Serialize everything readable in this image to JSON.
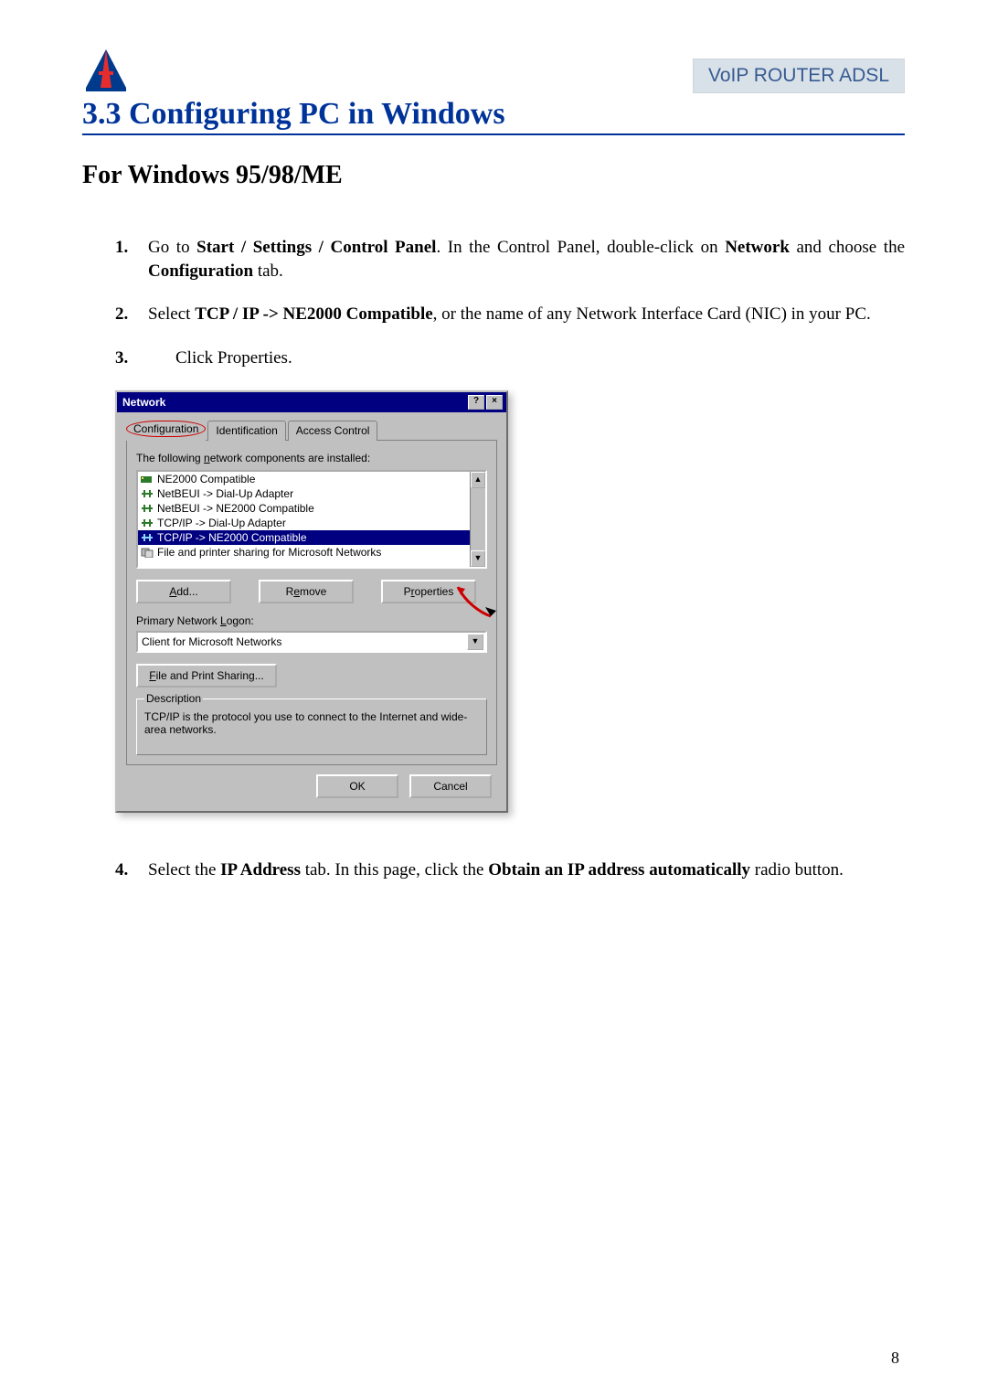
{
  "header": {
    "right_label": "VoIP ROUTER ADSL"
  },
  "section": {
    "heading": "3.3 Configuring PC in Windows",
    "subheading": "For Windows 95/98/ME"
  },
  "steps": {
    "s1": {
      "num": "1.",
      "pre": "Go to ",
      "bold1": "Start / Settings / Control Panel",
      "mid": ". In the Control Panel, double-click on ",
      "bold2": "Network",
      "post": " and choose the ",
      "bold3": "Configuration",
      "tail": " tab."
    },
    "s2": {
      "num": "2.",
      "pre": "Select ",
      "bold1": "TCP / IP -> NE2000 Compatible",
      "post": ", or the name of any Network Interface Card (NIC) in your PC."
    },
    "s3": {
      "num": "3.",
      "text": "Click Properties."
    },
    "s4": {
      "num": "4.",
      "pre": "Select the ",
      "bold1": "IP Address",
      "mid": " tab. In this page, click the ",
      "bold2": "Obtain an IP address automatically",
      "post": " radio button."
    }
  },
  "dialog": {
    "title": "Network",
    "help_btn": "?",
    "close_btn": "×",
    "tabs": {
      "t1": "Configuration",
      "t2": "Identification",
      "t3": "Access Control"
    },
    "panel": {
      "list_label_pre": "The following ",
      "list_label_u": "n",
      "list_label_post": "etwork components are installed:",
      "items": [
        "NE2000 Compatible",
        "NetBEUI -> Dial-Up Adapter",
        "NetBEUI -> NE2000 Compatible",
        "TCP/IP -> Dial-Up Adapter",
        "TCP/IP -> NE2000 Compatible",
        "File and printer sharing for Microsoft Networks"
      ],
      "add_u": "A",
      "add_rest": "dd...",
      "remove_pre": "R",
      "remove_u": "e",
      "remove_post": "move",
      "properties_pre": "P",
      "properties_u": "r",
      "properties_post": "operties",
      "logon_label_pre": "Primary Network ",
      "logon_label_u": "L",
      "logon_label_post": "ogon:",
      "logon_value": "Client for Microsoft Networks",
      "fps_u": "F",
      "fps_rest": "ile and Print Sharing...",
      "desc_legend": "Description",
      "desc_text": "TCP/IP is the protocol you use to connect to the Internet and wide-area networks."
    },
    "footer": {
      "ok": "OK",
      "cancel": "Cancel"
    }
  },
  "page_number": "8"
}
